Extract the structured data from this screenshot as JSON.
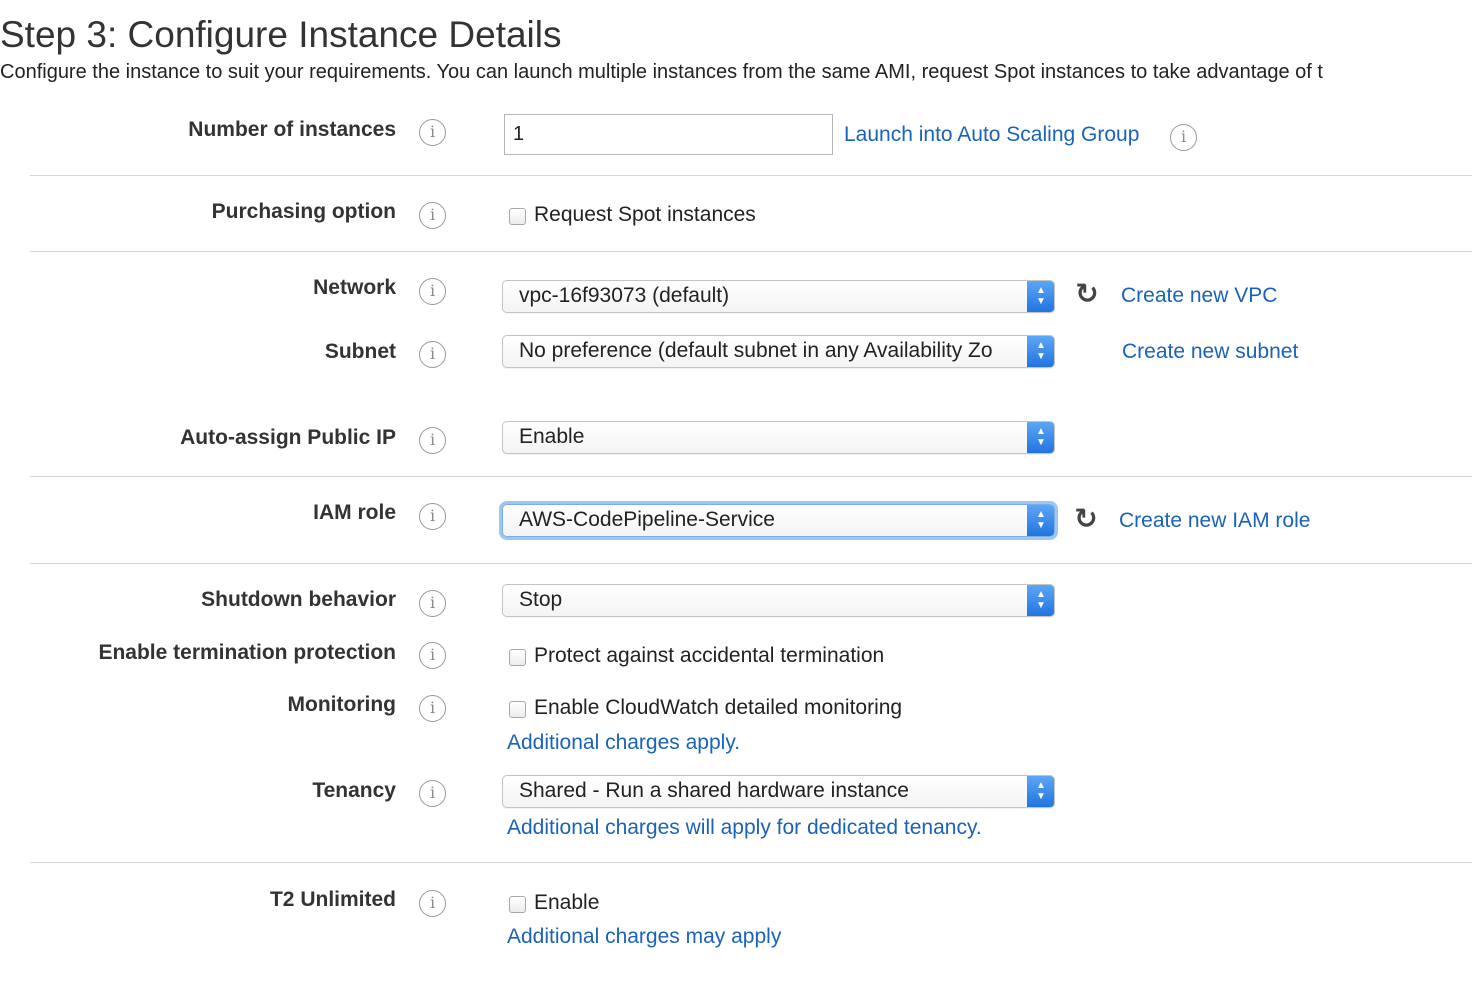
{
  "header": {
    "title": "Step 3: Configure Instance Details",
    "subtitle": "Configure the instance to suit your requirements. You can launch multiple instances from the same AMI, request Spot instances to take advantage of t"
  },
  "info_glyph": "i",
  "refresh_glyph": "↻",
  "select_arrows": "▲\n▼",
  "fields": {
    "num_instances": {
      "label": "Number of instances",
      "value": "1",
      "link": "Launch into Auto Scaling Group"
    },
    "purchasing": {
      "label": "Purchasing option",
      "checkbox_label": "Request Spot instances",
      "checked": false
    },
    "network": {
      "label": "Network",
      "value": "vpc-16f93073 (default)",
      "link": "Create new VPC"
    },
    "subnet": {
      "label": "Subnet",
      "value": "No preference (default subnet in any Availability Zo",
      "link": "Create new subnet"
    },
    "public_ip": {
      "label": "Auto-assign Public IP",
      "value": "Enable"
    },
    "iam_role": {
      "label": "IAM role",
      "value": "AWS-CodePipeline-Service",
      "link": "Create new IAM role"
    },
    "shutdown": {
      "label": "Shutdown behavior",
      "value": "Stop"
    },
    "termination": {
      "label": "Enable termination protection",
      "checkbox_label": "Protect against accidental termination",
      "checked": false
    },
    "monitoring": {
      "label": "Monitoring",
      "checkbox_label": "Enable CloudWatch detailed monitoring",
      "checked": false,
      "note_link": "Additional charges apply."
    },
    "tenancy": {
      "label": "Tenancy",
      "value": "Shared - Run a shared hardware instance",
      "note_link": "Additional charges will apply for dedicated tenancy."
    },
    "t2_unlimited": {
      "label": "T2 Unlimited",
      "checkbox_label": "Enable",
      "checked": false,
      "note_link": "Additional charges may apply"
    }
  },
  "colors": {
    "link": "#1a63b8",
    "select_accent": "#1f73e0",
    "divider": "#d5d5d5"
  }
}
